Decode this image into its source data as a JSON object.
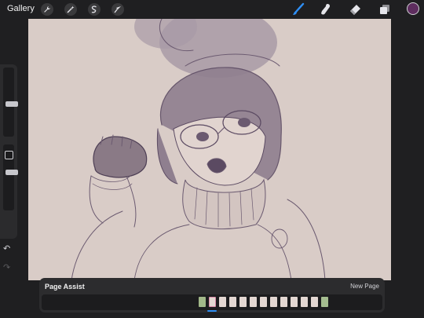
{
  "toolbar": {
    "gallery_label": "Gallery",
    "left_tools": [
      {
        "icon": "wrench-icon"
      },
      {
        "icon": "magic-wand-icon"
      },
      {
        "icon": "selection-icon"
      },
      {
        "icon": "transform-arrow-icon"
      }
    ],
    "right_tools": [
      {
        "icon": "brush-icon",
        "active": true
      },
      {
        "icon": "smudge-icon"
      },
      {
        "icon": "eraser-icon"
      },
      {
        "icon": "layers-icon"
      }
    ],
    "current_color": "#5e2d5f",
    "accent_color": "#2f8ff5"
  },
  "canvas": {
    "paper_color": "#d9ccc7",
    "ink_color": "#5b4a62"
  },
  "sidebar": {
    "brush_size_level": 0.55,
    "opacity_level": 0.45,
    "undo_icon": "undo-icon",
    "redo_icon": "redo-icon"
  },
  "page_assist": {
    "title": "Page Assist",
    "new_page_label": "New Page",
    "page_count": 13,
    "selected_page": 2
  }
}
